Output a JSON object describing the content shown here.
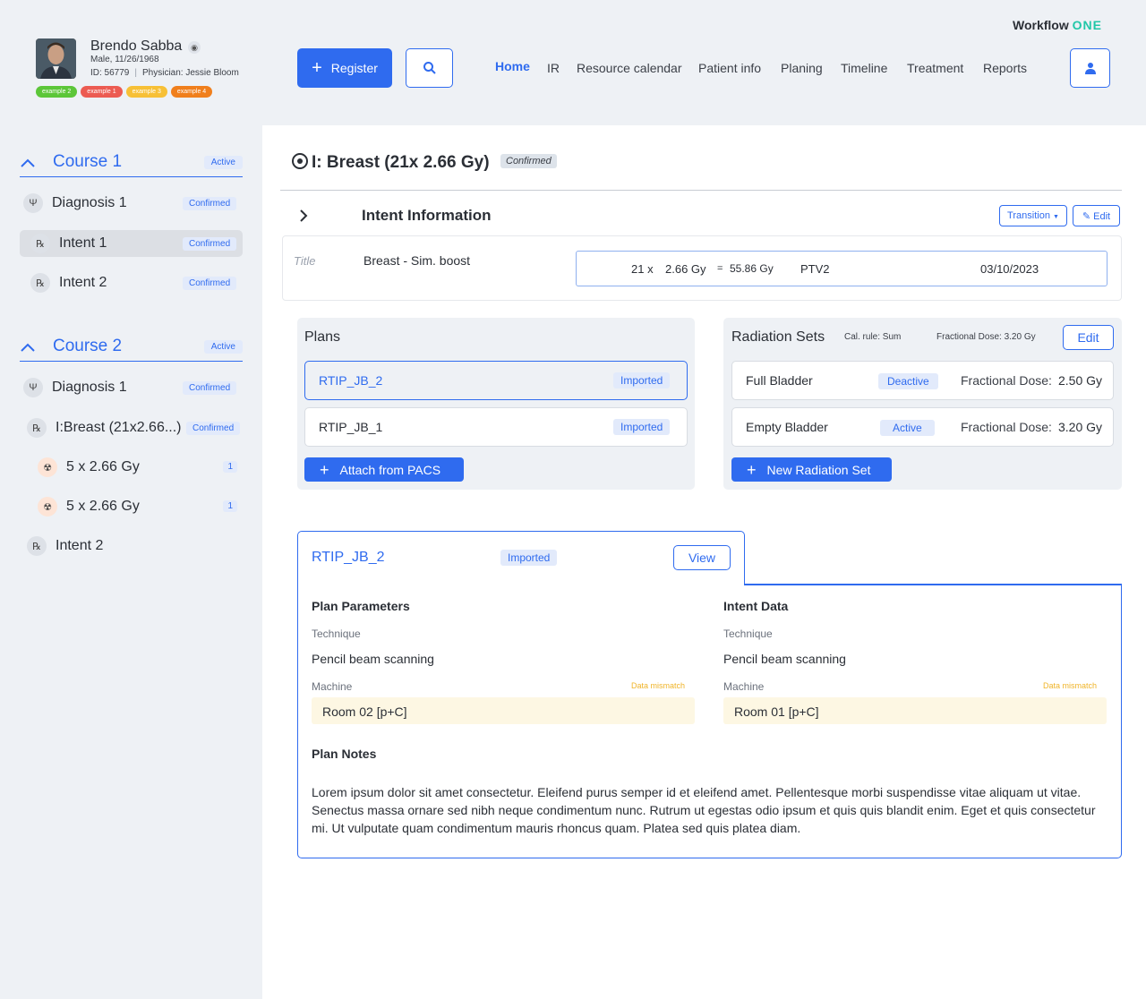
{
  "patient": {
    "name": "Brendo Sabba",
    "meta1": "Male, 11/26/1968",
    "id": "ID: 56779",
    "physician": "Physician: Jessie Bloom",
    "tags": [
      {
        "label": "example 2",
        "color": "#5cc639"
      },
      {
        "label": "example 1",
        "color": "#ec5b52"
      },
      {
        "label": "example 3",
        "color": "#f7c036"
      },
      {
        "label": "example 4",
        "color": "#f07f1c"
      }
    ]
  },
  "header": {
    "register_label": "Register",
    "nav": [
      "Home",
      "IR",
      "Resource calendar",
      "Patient info",
      "Planing",
      "Timeline",
      "Treatment",
      "Reports"
    ],
    "logo_text": "Workflow ",
    "logo_one": "ONE"
  },
  "sidebar": {
    "course1": {
      "title": "Course 1",
      "badge": "Active"
    },
    "course1_items": [
      {
        "label": "Diagnosis 1",
        "badge": "Confirmed"
      },
      {
        "label": "Intent 1",
        "badge": "Confirmed"
      },
      {
        "label": "Intent 2",
        "badge": "Confirmed"
      }
    ],
    "course2": {
      "title": "Course 2",
      "badge": "Active"
    },
    "course2_items": [
      {
        "label": "Diagnosis 1",
        "badge": "Confirmed"
      },
      {
        "label": "I:Breast (21x2.66...)",
        "badge": "Confirmed"
      },
      {
        "label": "5 x 2.66 Gy",
        "count": "1"
      },
      {
        "label": "5 x 2.66 Gy",
        "count": "1"
      },
      {
        "label": "Intent 2"
      }
    ]
  },
  "intent": {
    "title": "I: Breast (21x 2.66 Gy)",
    "status": "Confirmed",
    "section_title": "Intent Information",
    "transition_label": "Transition",
    "edit_label": "Edit",
    "title_label": "Title",
    "title_value": "Breast - Sim. boost",
    "fractions": "21 x",
    "dose": "2.66 Gy",
    "equals": "=",
    "total": "55.86 Gy",
    "target": "PTV2",
    "date": "03/10/2023"
  },
  "plans": {
    "title": "Plans",
    "items": [
      {
        "label": "RTIP_JB_2",
        "badge": "Imported"
      },
      {
        "label": "RTIP_JB_1",
        "badge": "Imported"
      }
    ],
    "attach_label": "Attach from PACS"
  },
  "radiation_sets": {
    "title": "Radiation Sets",
    "cal_rule": "Cal. rule:  Sum",
    "fractional_dose": "Fractional Dose:  3.20 Gy",
    "edit_label": "Edit",
    "items": [
      {
        "label": "Full Bladder",
        "badge": "Deactive",
        "fd_label": "Fractional Dose:",
        "fd_value": "2.50 Gy"
      },
      {
        "label": "Empty Bladder",
        "badge": "Active",
        "fd_label": "Fractional Dose:",
        "fd_value": "3.20 Gy"
      }
    ],
    "new_label": "New Radiation Set"
  },
  "detail": {
    "plan_name": "RTIP_JB_2",
    "badge": "Imported",
    "view_label": "View",
    "plan_params_title": "Plan  Parameters",
    "intent_data_title": "Intent Data",
    "technique_label": "Technique",
    "plan_technique": "Pencil beam scanning",
    "intent_technique": "Pencil beam scanning",
    "machine_label": "Machine",
    "mismatch_label": "Data mismatch",
    "plan_machine": "Room 02 [p+C]",
    "intent_machine": "Room 01 [p+C]",
    "notes_title": "Plan Notes",
    "notes": "Lorem ipsum dolor sit amet consectetur. Eleifend purus semper id et eleifend amet. Pellentesque morbi suspendisse vitae aliquam ut vitae. Senectus massa ornare sed nibh neque condimentum nunc. Rutrum ut egestas odio ipsum et quis quis blandit enim. Eget et quis consectetur mi. Ut vulputate quam condimentum mauris rhoncus quam. Platea sed quis platea diam."
  }
}
